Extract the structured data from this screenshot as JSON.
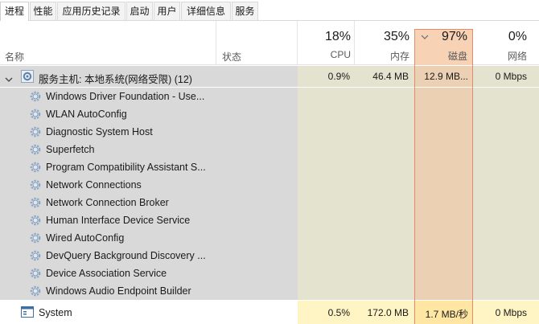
{
  "tabs": [
    {
      "label": "进程",
      "active": true
    },
    {
      "label": "性能"
    },
    {
      "label": "应用历史记录"
    },
    {
      "label": "启动"
    },
    {
      "label": "用户"
    },
    {
      "label": "详细信息"
    },
    {
      "label": "服务"
    }
  ],
  "header": {
    "name_label": "名称",
    "status_label": "状态",
    "cpu": {
      "percent": "18%",
      "label": "CPU"
    },
    "memory": {
      "percent": "35%",
      "label": "内存"
    },
    "disk": {
      "percent": "97%",
      "label": "磁盘",
      "sort_icon": "chevron-down-icon"
    },
    "network": {
      "percent": "0%",
      "label": "网络"
    }
  },
  "group": {
    "name": "服务主机: 本地系统(网络受限) (12)",
    "cpu": "0.9%",
    "memory": "46.4 MB",
    "disk": "12.9 MB...",
    "network": "0 Mbps",
    "icon": "gear-icon",
    "expander_icon": "chevron-down-icon"
  },
  "services": [
    "Windows Driver Foundation - Use...",
    "WLAN AutoConfig",
    "Diagnostic System Host",
    "Superfetch",
    "Program Compatibility Assistant S...",
    "Network Connections",
    "Network Connection Broker",
    "Human Interface Device Service",
    "Wired AutoConfig",
    "DevQuery Background Discovery ...",
    "Device Association Service",
    "Windows Audio Endpoint Builder"
  ],
  "system_row": {
    "name": "System",
    "cpu": "0.5%",
    "memory": "172.0 MB",
    "disk": "1.7 MB/秒",
    "network": "0 Mbps",
    "icon": "window-icon"
  },
  "colors": {
    "disk_highlight": "#ebd0b3",
    "disk_border": "#e58b6a",
    "resource_cell": "#e4e3cf",
    "row_grey": "#d9d9d9",
    "system_cell": "#fff4c4"
  }
}
